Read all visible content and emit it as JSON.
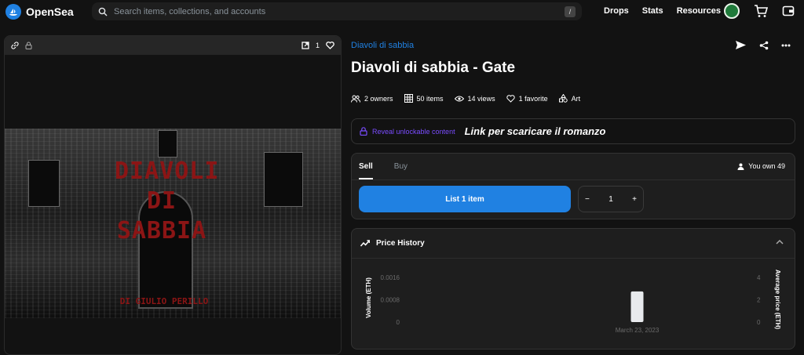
{
  "nav": {
    "brand": "OpenSea",
    "search_placeholder": "Search items, collections, and accounts",
    "search_shortcut": "/",
    "links": [
      "Drops",
      "Stats",
      "Resources"
    ]
  },
  "media": {
    "favorite_count": "1",
    "art_title": "DIAVOLI DI SABBIA",
    "art_subtitle": "DI GIULIO PERILLO"
  },
  "item": {
    "collection": "Diavoli di sabbia",
    "title": "Diavoli di sabbia - Gate",
    "meta": {
      "owners": "2 owners",
      "items": "50 items",
      "views": "14 views",
      "favorites": "1 favorite",
      "category": "Art"
    }
  },
  "unlockable": {
    "label": "Reveal unlockable content",
    "note": "Link per scaricare il romanzo"
  },
  "trade": {
    "tabs": [
      "Sell",
      "Buy"
    ],
    "you_own": "You own 49",
    "list_button": "List 1 item",
    "quantity": "1",
    "minus": "−",
    "plus": "+"
  },
  "price_history": {
    "title": "Price History"
  },
  "chart_data": {
    "type": "bar",
    "categories": [
      "March 23, 2023"
    ],
    "series": [
      {
        "values": [
          0.0011
        ]
      }
    ],
    "left_ticks": [
      "0.0016",
      "0.0008",
      "0"
    ],
    "right_ticks": [
      "4",
      "2",
      "0"
    ],
    "ylabel": "Volume (ETH)",
    "y2label": "Average price (ETH)",
    "ylim": [
      0,
      0.0016
    ],
    "y2lim": [
      0,
      4
    ]
  },
  "colors": {
    "accent": "#2081e2",
    "unlock": "#7a4cff",
    "art_text": "#8b1515"
  }
}
